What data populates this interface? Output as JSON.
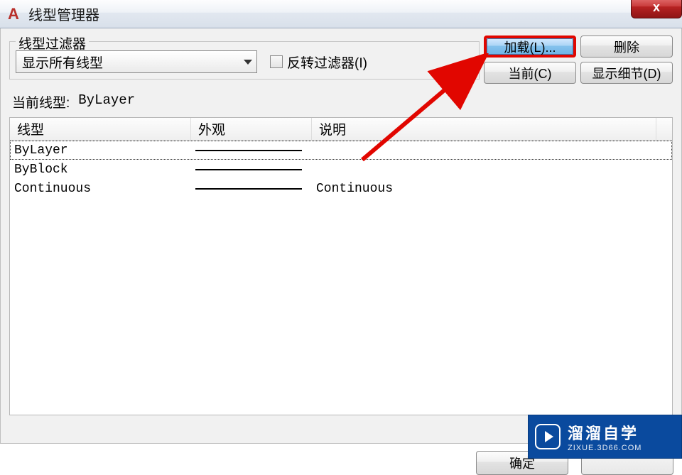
{
  "window": {
    "title": "线型管理器",
    "app_icon_letter": "A",
    "close_symbol": "x"
  },
  "filter": {
    "legend": "线型过滤器",
    "dropdown_value": "显示所有线型",
    "invert_label": "反转过滤器(I)"
  },
  "buttons": {
    "load": "加载(L)...",
    "delete": "删除",
    "current": "当前(C)",
    "details": "显示细节(D)",
    "ok": "确定",
    "cancel": ""
  },
  "current_linetype": {
    "label": "当前线型:",
    "value": "ByLayer"
  },
  "table": {
    "headers": {
      "name": "线型",
      "appearance": "外观",
      "description": "说明"
    },
    "rows": [
      {
        "name": "ByLayer",
        "has_sample": true,
        "description": "",
        "selected": true
      },
      {
        "name": "ByBlock",
        "has_sample": true,
        "description": "",
        "selected": false
      },
      {
        "name": "Continuous",
        "has_sample": true,
        "description": "Continuous",
        "selected": false
      }
    ]
  },
  "watermark": {
    "brand": "溜溜自学",
    "url": "ZIXUE.3D66.COM"
  }
}
